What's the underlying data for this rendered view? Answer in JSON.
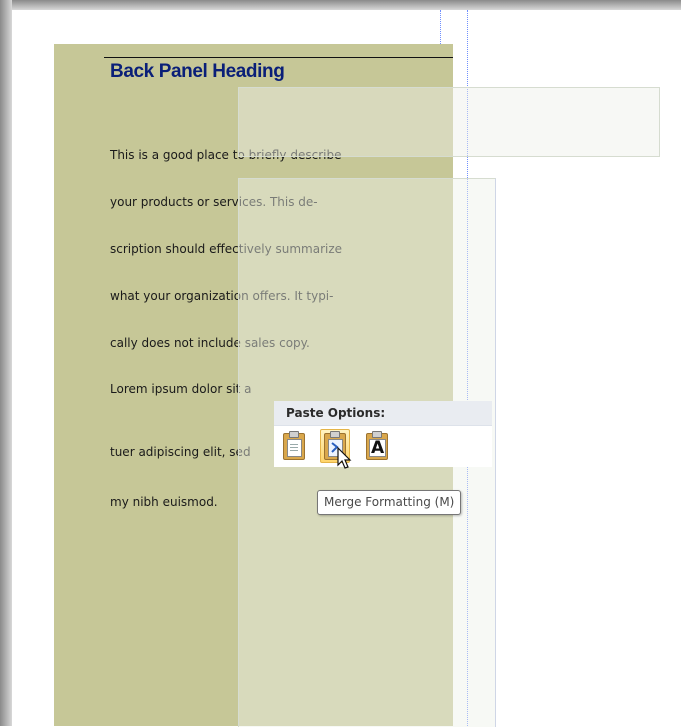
{
  "panel": {
    "heading": "Back Panel Heading",
    "lines": [
      "This is a good place to briefly describe",
      "your products or services. This de-",
      "scription should effectively summarize",
      "what your organization offers. It typi-",
      "cally does not include sales copy.",
      "Lorem ipsum dolor sit a",
      "tuer adipiscing elit, sed",
      "my nibh euismod."
    ],
    "color": "#c6c797",
    "heading_color": "#0a1f78"
  },
  "paste_options": {
    "title": "Paste Options:",
    "buttons": [
      {
        "name": "keep-source-formatting",
        "icon": "clipboard-document-icon"
      },
      {
        "name": "merge-formatting",
        "icon": "clipboard-merge-icon"
      },
      {
        "name": "keep-text-only",
        "icon": "letter-a-icon",
        "glyph": "A"
      }
    ],
    "active_index": 1
  },
  "tooltip": {
    "text": "Merge Formatting (M)"
  }
}
